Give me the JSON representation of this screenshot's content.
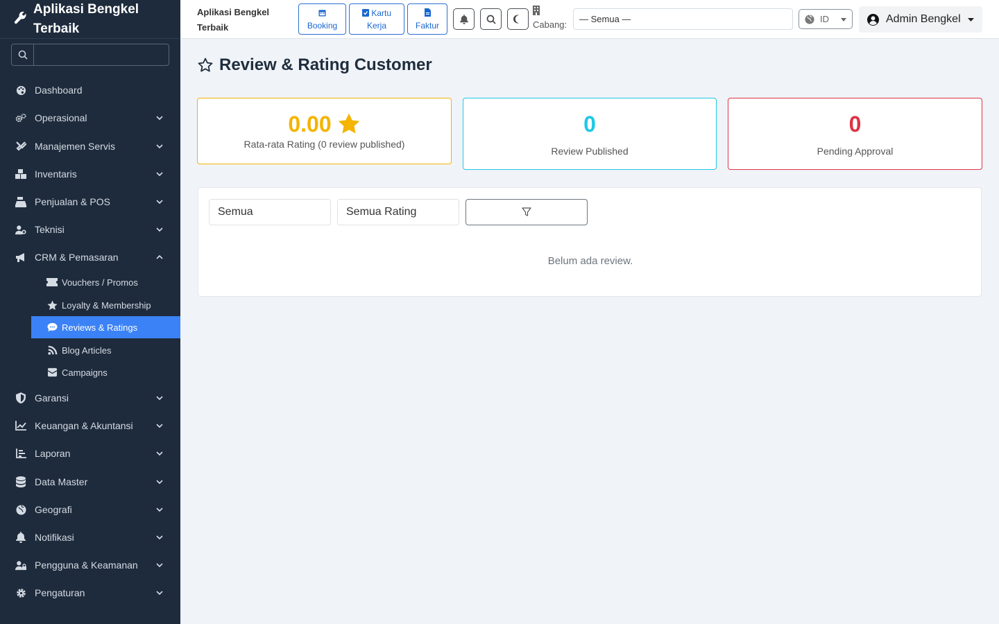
{
  "app": {
    "title": "Aplikasi Bengkel Terbaik"
  },
  "sidebar": {
    "search_placeholder": "",
    "items": [
      {
        "label": "Dashboard",
        "icon": "palette-icon"
      },
      {
        "label": "Operasional",
        "icon": "gears-icon"
      },
      {
        "label": "Manajemen Servis",
        "icon": "tools-icon"
      },
      {
        "label": "Inventaris",
        "icon": "boxes-icon"
      },
      {
        "label": "Penjualan & POS",
        "icon": "cash-register-icon"
      },
      {
        "label": "Teknisi",
        "icon": "user-gear-icon"
      },
      {
        "label": "CRM & Pemasaran",
        "icon": "bullhorn-icon"
      },
      {
        "label": "Garansi",
        "icon": "shield-icon"
      },
      {
        "label": "Keuangan & Akuntansi",
        "icon": "chart-line-icon"
      },
      {
        "label": "Laporan",
        "icon": "chart-bar-icon"
      },
      {
        "label": "Data Master",
        "icon": "database-icon"
      },
      {
        "label": "Geografi",
        "icon": "globe-icon"
      },
      {
        "label": "Notifikasi",
        "icon": "bell-icon"
      },
      {
        "label": "Pengguna & Keamanan",
        "icon": "user-lock-icon"
      },
      {
        "label": "Pengaturan",
        "icon": "gear-icon"
      }
    ],
    "crm_sub": [
      {
        "label": "Vouchers / Promos",
        "icon": "ticket-icon"
      },
      {
        "label": "Loyalty & Membership",
        "icon": "star-icon"
      },
      {
        "label": "Reviews & Ratings",
        "icon": "comment-icon"
      },
      {
        "label": "Blog Articles",
        "icon": "blog-icon"
      },
      {
        "label": "Campaigns",
        "icon": "mail-bulk-icon"
      }
    ]
  },
  "topbar": {
    "title": "Aplikasi Bengkel Terbaik",
    "booking_label": "Booking",
    "kartu_label_1": "Kartu",
    "kartu_label_2": "Kerja",
    "faktur_label": "Faktur",
    "cabang_label": "Cabang:",
    "cabang_value": "— Semua —",
    "lang_value": "ID",
    "user_name": "Admin Bengkel"
  },
  "main": {
    "page_title": "Review & Rating Customer",
    "stats": {
      "avg_rating": "0.00",
      "avg_label": "Rata-rata Rating (0 review published)",
      "published": "0",
      "published_label": "Review Published",
      "pending": "0",
      "pending_label": "Pending Approval"
    },
    "filters": {
      "status_value": "Semua",
      "rating_value": "Semua Rating"
    },
    "empty_text": "Belum ada review."
  },
  "colors": {
    "sidebar_bg": "#1e2b3c",
    "active_item": "#3b82f6",
    "primary": "#1a66d0",
    "warning": "#f4b400",
    "info": "#1ec8e6",
    "danger": "#dc3545"
  }
}
